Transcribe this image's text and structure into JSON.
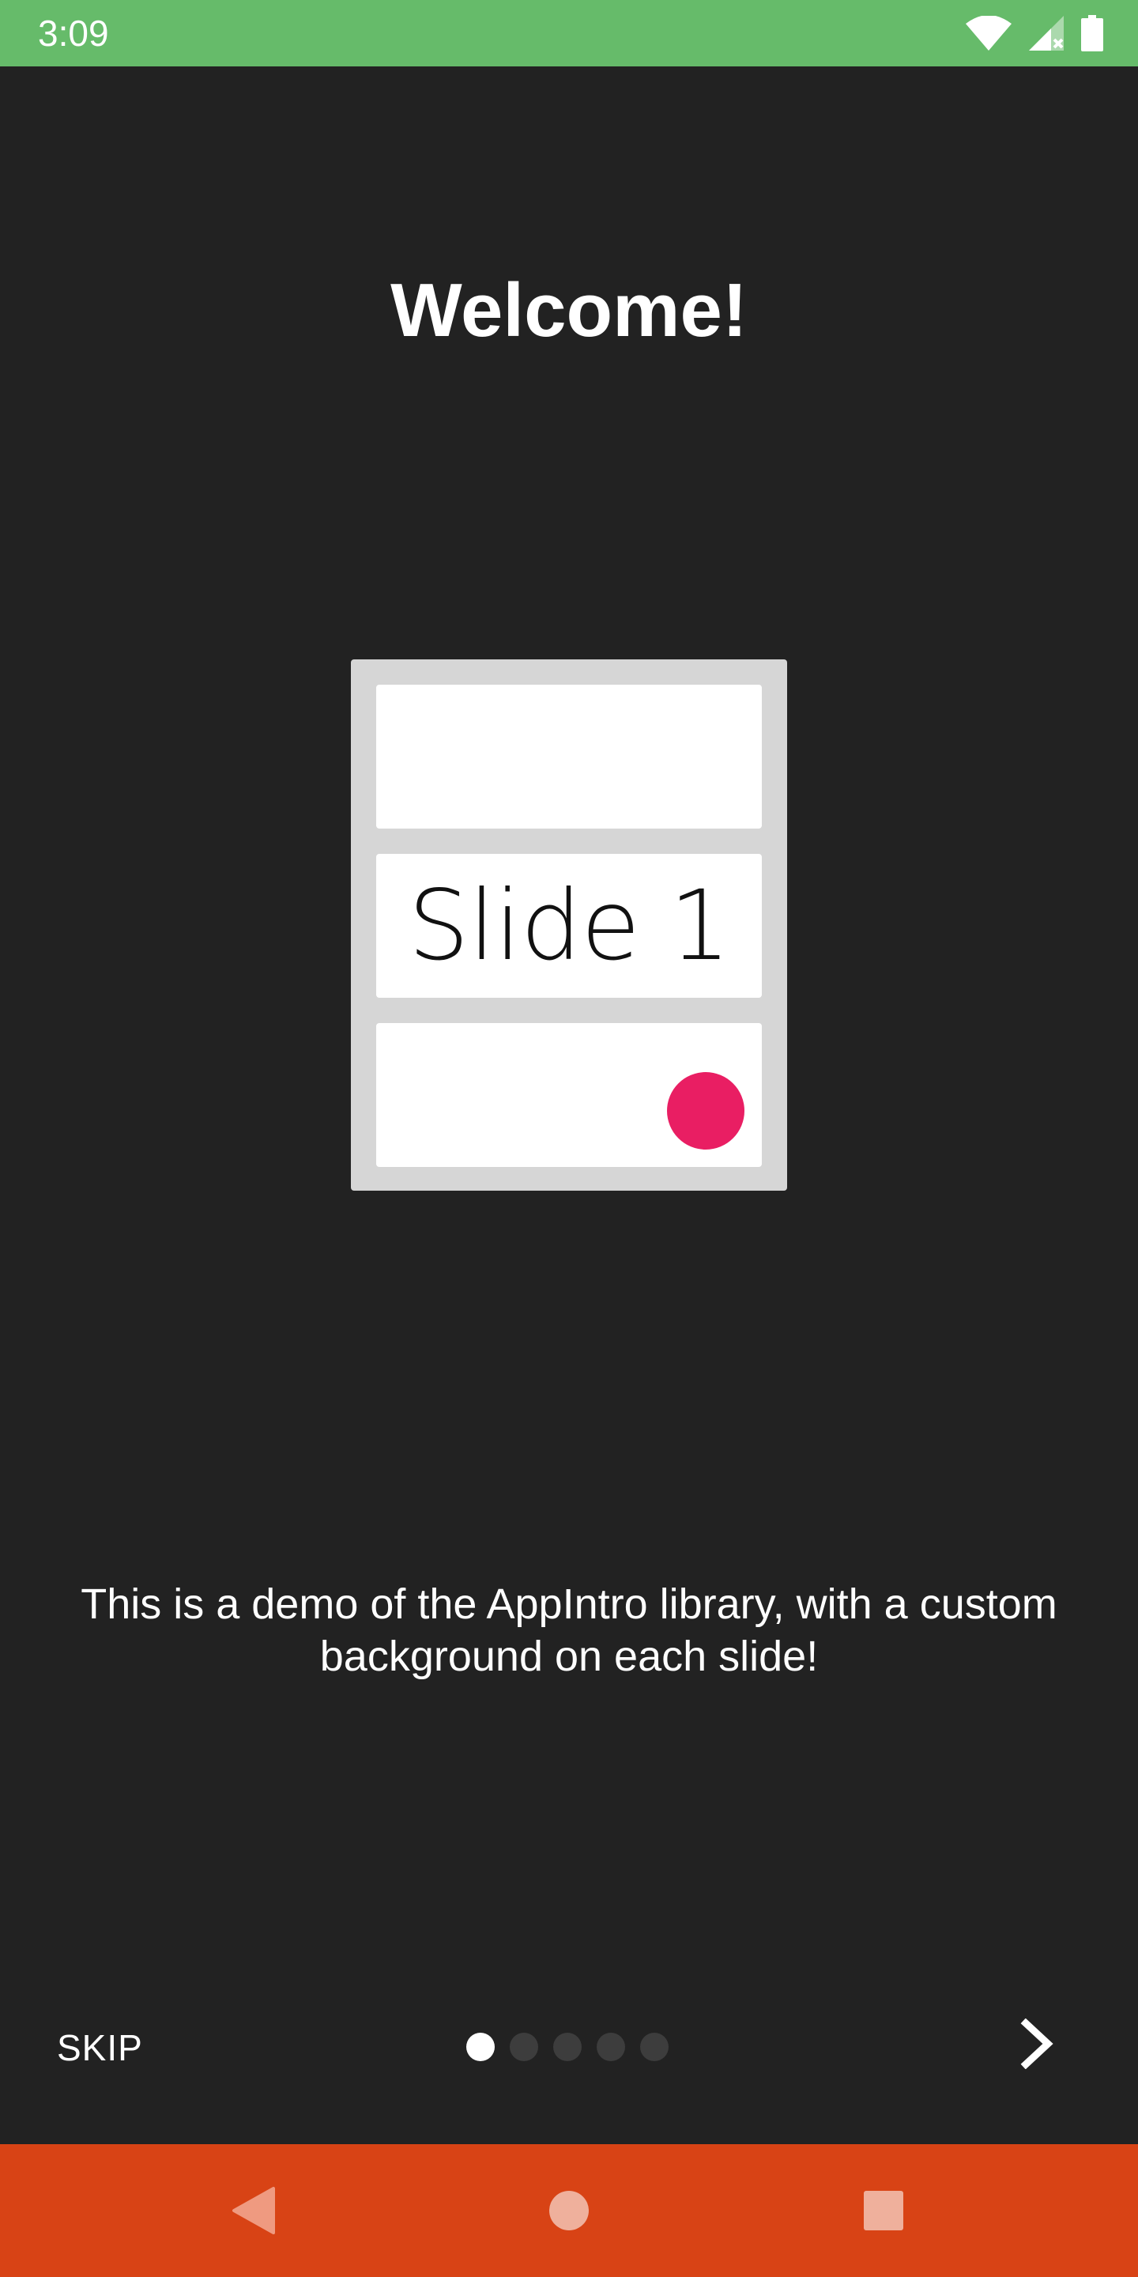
{
  "status_bar": {
    "time": "3:09",
    "background_color": "#66bb6a",
    "icons": [
      "wifi-icon",
      "cell-signal-icon",
      "battery-icon"
    ]
  },
  "slide": {
    "title": "Welcome!",
    "illustration_label": "Slide 1",
    "description": "This is a demo of the AppIntro library, with a custom background on each slide!",
    "background_color": "#222222",
    "accent_color": "#e91e63"
  },
  "controls": {
    "skip_label": "SKIP",
    "next_icon": "chevron-right-icon",
    "page_count": 5,
    "current_page": 1
  },
  "nav_bar": {
    "background_color": "#d84315",
    "icons": [
      "back-icon",
      "home-icon",
      "recents-icon"
    ]
  }
}
